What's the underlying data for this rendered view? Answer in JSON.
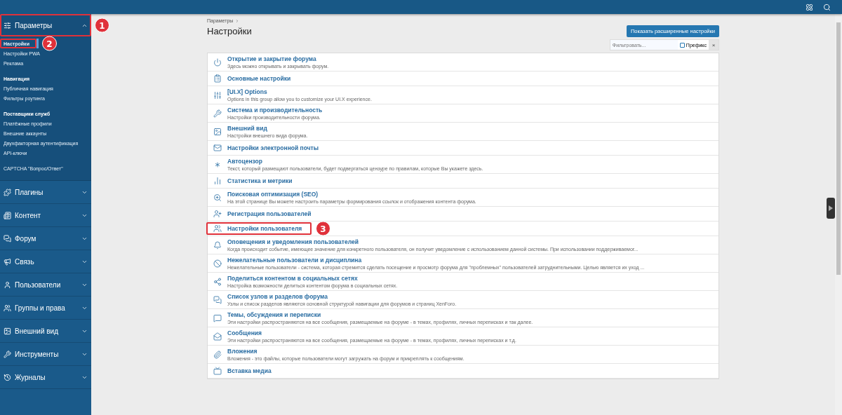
{
  "sidebar": {
    "groups": [
      {
        "label": "Параметры",
        "expanded": true,
        "callout": "1",
        "sections": [
          {
            "items": [
              {
                "label": "Настройки",
                "selected": true,
                "callout": "2"
              },
              {
                "label": "Настройки PWA",
                "selected": false
              },
              {
                "label": "Реклама",
                "selected": false
              }
            ]
          },
          {
            "heading": "Навигация",
            "items": [
              {
                "label": "Публичная навигация",
                "selected": false
              },
              {
                "label": "Фильтры роутинга",
                "selected": false
              }
            ]
          },
          {
            "heading": "Поставщики служб",
            "items": [
              {
                "label": "Платёжные профили",
                "selected": false
              },
              {
                "label": "Внешние аккаунты",
                "selected": false
              },
              {
                "label": "Двухфакторная аутентификация",
                "selected": false
              },
              {
                "label": "API-ключи",
                "selected": false
              }
            ]
          },
          {
            "items": [
              {
                "label": "CAPTCHA \"Вопрос/Ответ\"",
                "selected": false
              }
            ]
          }
        ]
      },
      {
        "label": "Плагины",
        "expanded": false
      },
      {
        "label": "Контент",
        "expanded": false
      },
      {
        "label": "Форум",
        "expanded": false
      },
      {
        "label": "Связь",
        "expanded": false
      },
      {
        "label": "Пользователи",
        "expanded": false
      },
      {
        "label": "Группы и права",
        "expanded": false
      },
      {
        "label": "Внешний вид",
        "expanded": false
      },
      {
        "label": "Инструменты",
        "expanded": false
      },
      {
        "label": "Журналы",
        "expanded": false
      }
    ]
  },
  "breadcrumb": "Параметры",
  "title": "Настройки",
  "advanced_button": "Показать расширенные настройки",
  "filter": {
    "placeholder": "Фильтровать...",
    "prefix_label": "Префикс",
    "prefix_checked": false,
    "clear": "×"
  },
  "options": [
    {
      "title": "Открытие и закрытие форума",
      "description": "Здесь можно открывать и закрывать форум."
    },
    {
      "title": "Основные настройки"
    },
    {
      "title": "[UI.X] Options",
      "description": "Options in this group allow you to customize your UI.X experience."
    },
    {
      "title": "Система и производительность",
      "description": "Настройки производительности форума."
    },
    {
      "title": "Внешний вид",
      "description": "Настройки внешнего вида форума."
    },
    {
      "title": "Настройки электронной почты"
    },
    {
      "title": "Автоцензор",
      "description": "Текст, который размещают пользователи, будет подвергаться цензуре по правилам, которые Вы укажете здесь."
    },
    {
      "title": "Статистика и метрики"
    },
    {
      "title": "Поисковая оптимизация (SEO)",
      "description": "На этой странице Вы можете настроить параметры формирования ссылок и отображения контента форума."
    },
    {
      "title": "Регистрация пользователей"
    },
    {
      "title": "Настройки пользователя",
      "callout": "3"
    },
    {
      "title": "Оповещения и уведомления пользователей",
      "description": "Когда происходит событие, имеющее значение для конкретного пользователя, он получит уведомление с использованием данной системы. При использовании поддерживаемог..."
    },
    {
      "title": "Нежелательные пользователи и дисциплина",
      "description": "Нежелательные пользователи - система, которая стремится сделать посещение и просмотр форума для \"проблемных\" пользователей затруднительными. Целью является их уход ..."
    },
    {
      "title": "Поделиться контентом в социальных сетях",
      "description": "Настройка возможности делиться контентом форума в социальных сетях."
    },
    {
      "title": "Список узлов и разделов форума",
      "description": "Узлы и список разделов являются основной структурой навигации для форумов и страниц XenForo."
    },
    {
      "title": "Темы, обсуждения и переписки",
      "description": "Эти настройки распространяются на все сообщения, размещаемые на форуме - в темах, профилях, личных переписках и так далее."
    },
    {
      "title": "Сообщения",
      "description": "Эти настройки распространяются на все сообщения, размещаемые на форуме - в темах, профилях, личных переписках и т.д."
    },
    {
      "title": "Вложения",
      "description": "Вложения - это файлы, которые пользователи могут загружать на форум и прикреплять к сообщениям."
    },
    {
      "title": "Вставка медиа"
    }
  ]
}
